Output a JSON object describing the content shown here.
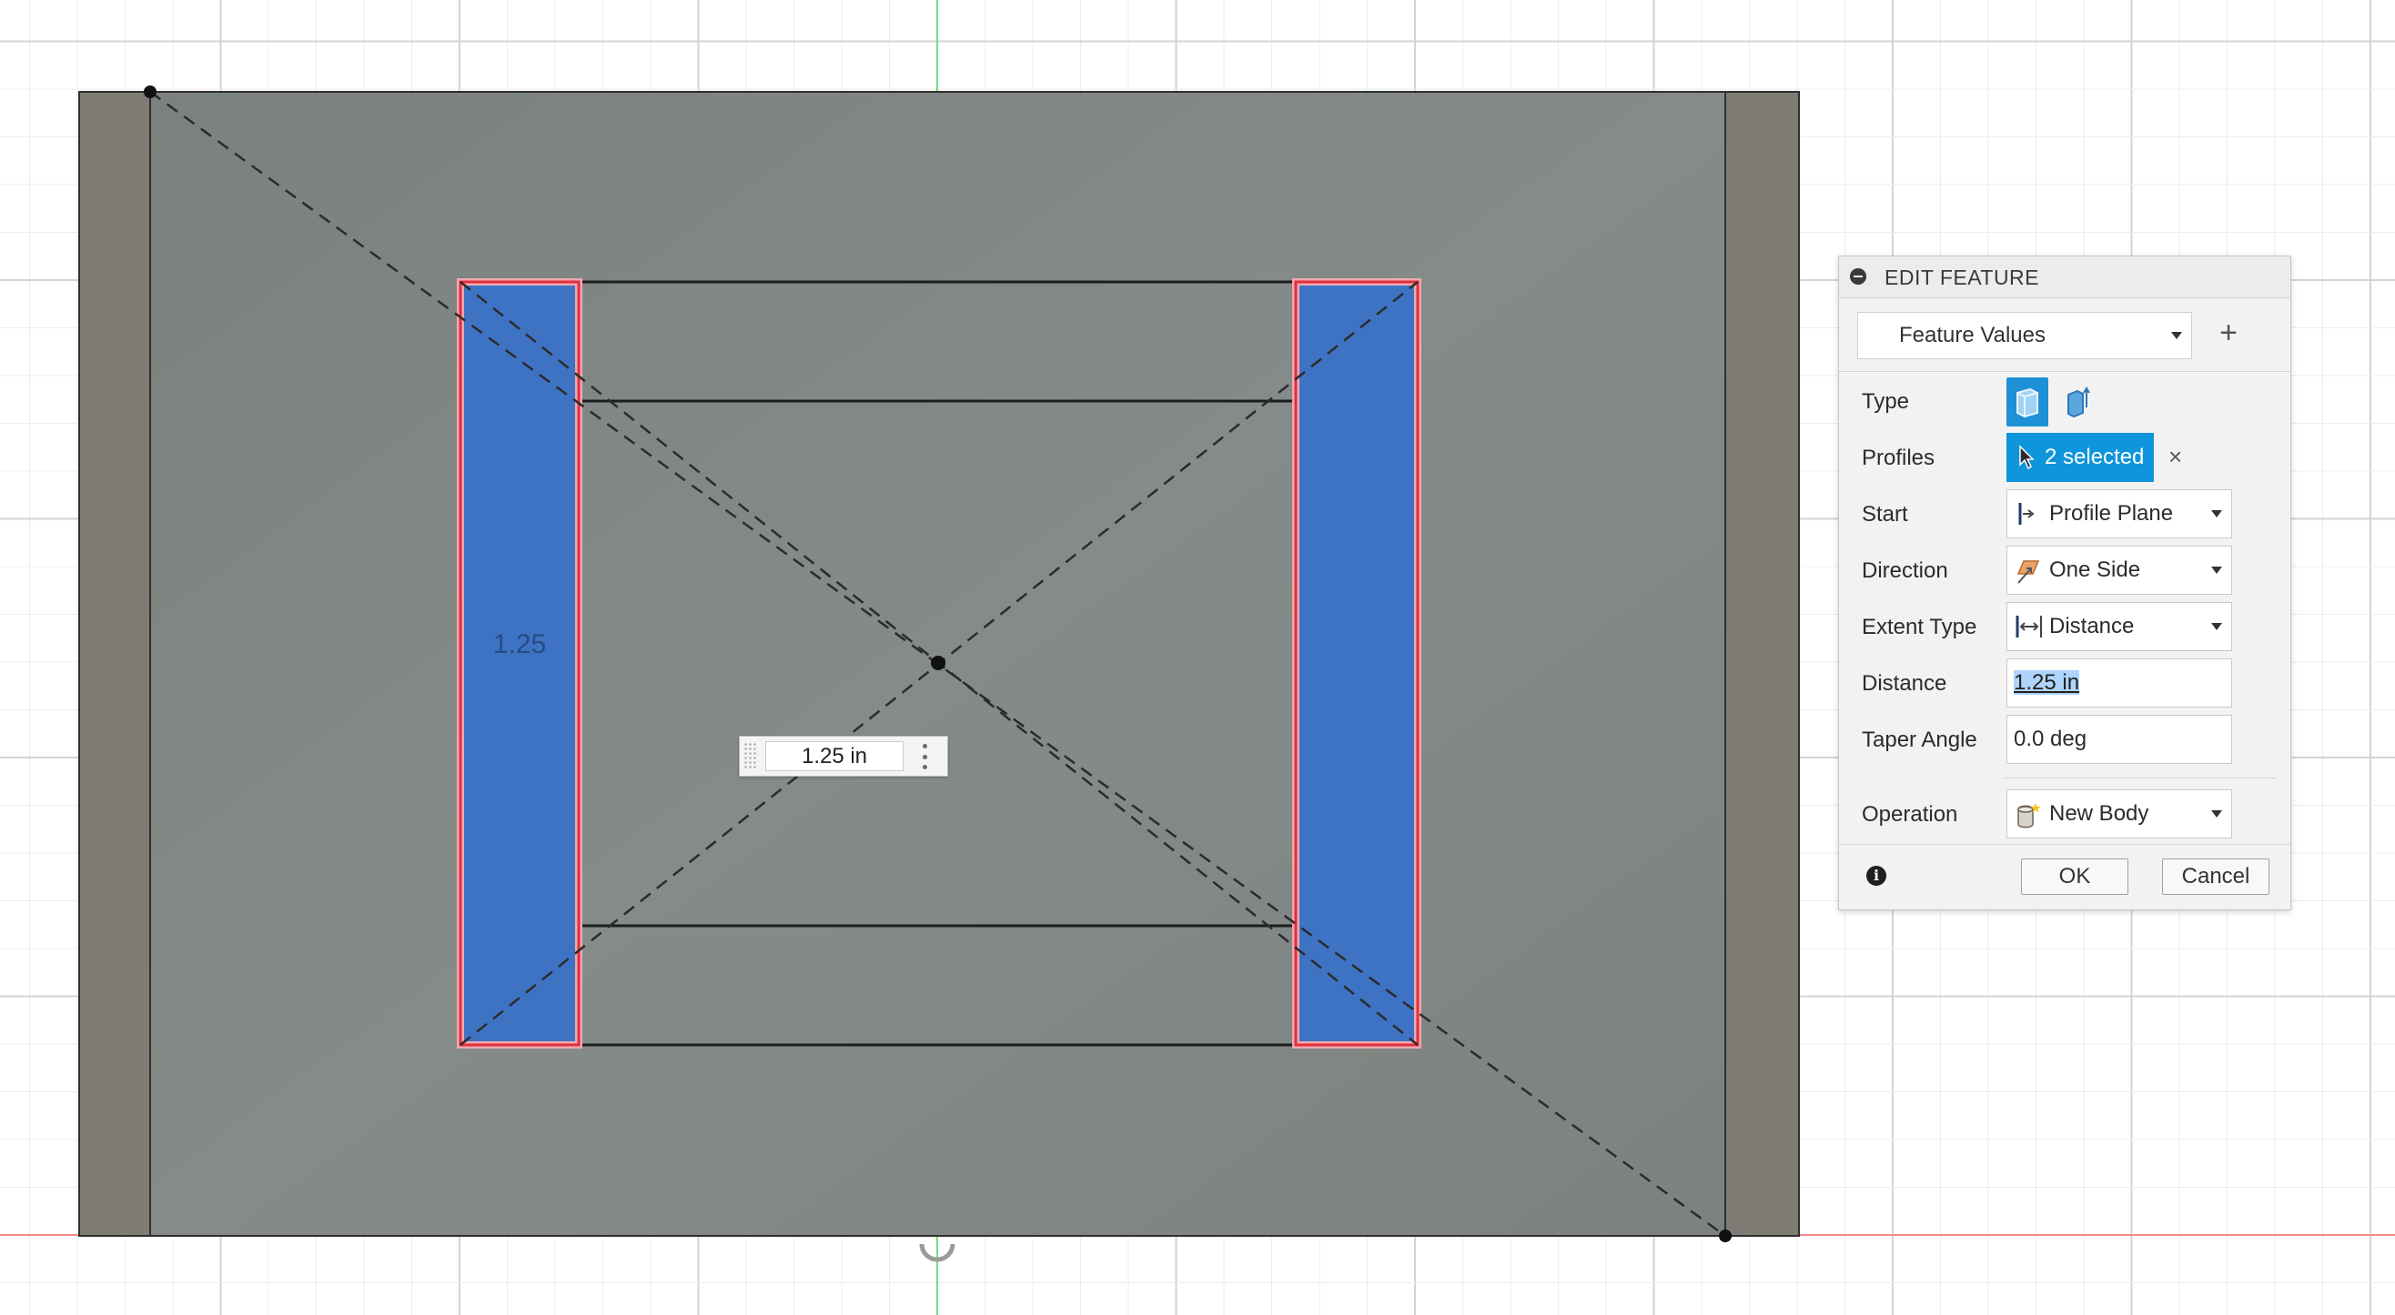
{
  "canvas": {
    "profile_dimension_text": "1.25",
    "distance_input_value": "1.25 in"
  },
  "panel": {
    "title": "EDIT FEATURE",
    "preset": "Feature Values",
    "rows": {
      "type_label": "Type",
      "profiles_label": "Profiles",
      "profiles_value": "2 selected",
      "start_label": "Start",
      "start_value": "Profile Plane",
      "direction_label": "Direction",
      "direction_value": "One Side",
      "extent_label": "Extent Type",
      "extent_value": "Distance",
      "distance_label": "Distance",
      "distance_value": "1.25 in",
      "taper_label": "Taper Angle",
      "taper_value": "0.0 deg",
      "operation_label": "Operation",
      "operation_value": "New Body"
    },
    "buttons": {
      "ok": "OK",
      "cancel": "Cancel"
    }
  }
}
